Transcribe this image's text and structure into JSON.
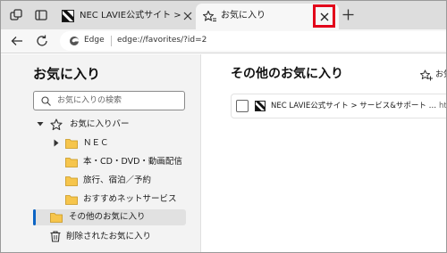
{
  "tabs": [
    {
      "title": "NEC LAVIE公式サイト > サービス&サポート > ホーム",
      "active": false
    },
    {
      "title": "お気に入り",
      "active": true
    }
  ],
  "toolbar": {
    "site_label": "Edge",
    "url": "edge://favorites/?id=2"
  },
  "sidebar": {
    "title": "お気に入り",
    "search_placeholder": "お気に入りの検索",
    "tree": [
      {
        "label": "お気に入りバー",
        "icon": "star-icon",
        "expanded": true
      },
      {
        "label": "ＮＥＣ",
        "icon": "folder-icon",
        "collapsed": true
      },
      {
        "label": "本・CD・DVD・動画配信",
        "icon": "folder-icon"
      },
      {
        "label": "旅行、宿泊／予約",
        "icon": "folder-icon"
      },
      {
        "label": "おすすめネットサービス",
        "icon": "folder-icon"
      },
      {
        "label": "その他のお気に入り",
        "icon": "folder-icon",
        "selected": true
      },
      {
        "label": "削除されたお気に入り",
        "icon": "trash-icon"
      }
    ]
  },
  "main": {
    "title": "その他のお気に入り",
    "add_label": "お気",
    "items": [
      {
        "title": "NEC LAVIE公式サイト > サービス&サポート > ホ…",
        "url": "htt"
      }
    ]
  },
  "colors": {
    "highlight": "#e2001a",
    "selection_accent": "#0c64c4",
    "folder": "#f6c54c"
  }
}
